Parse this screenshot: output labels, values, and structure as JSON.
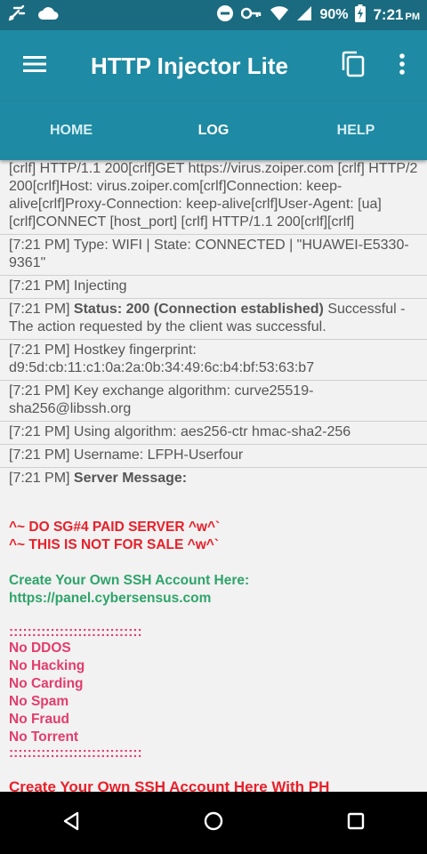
{
  "status_bar": {
    "battery": "90%",
    "time": "7:21",
    "ampm": "PM",
    "icons": [
      "bolt-app-icon",
      "cloud-icon",
      "minus-circle-icon",
      "key-icon",
      "wifi-icon",
      "signal-icon",
      "battery-charging-icon"
    ]
  },
  "app_bar": {
    "title": "HTTP Injector Lite",
    "icons": [
      "menu-icon",
      "copy-icon",
      "more-vert-icon"
    ]
  },
  "tabs": {
    "home": "HOME",
    "log": "LOG",
    "help": "HELP",
    "active": "LOG"
  },
  "log": {
    "payload": "[crlf] HTTP/1.1 200[crlf]GET https://virus.zoiper.com [crlf] HTTP/2 200[crlf]Host: virus.zoiper.com[crlf]Connection: keep-alive[crlf]Proxy-Connection: keep-alive[crlf]User-Agent: [ua][crlf]CONNECT [host_port] [crlf] HTTP/1.1 200[crlf][crlf]",
    "entries": [
      {
        "time": "[7:21 PM]",
        "text": " Type: WIFI | State: CONNECTED | \"HUAWEI-E5330-9361\""
      },
      {
        "time": "[7:21 PM]",
        "text": " Injecting"
      },
      {
        "time": "[7:21 PM]",
        "bold": " Status: 200 (Connection established)",
        "text": " Successful - The action requested by the client was successful."
      },
      {
        "time": "[7:21 PM]",
        "text": " Hostkey fingerprint: d9:5d:cb:11:c1:0a:2a:0b:34:49:6c:b4:bf:53:63:b7"
      },
      {
        "time": "[7:21 PM]",
        "text": " Key exchange algorithm: curve25519-sha256@libssh.org"
      },
      {
        "time": "[7:21 PM]",
        "text": " Using algorithm: aes256-ctr hmac-sha2-256"
      },
      {
        "time": "[7:21 PM]",
        "text": " Username: LFPH-Userfour"
      },
      {
        "time": "[7:21 PM]",
        "bold": " Server Message:"
      }
    ],
    "server_message": {
      "line1": "^~ DO SG#4 PAID SERVER ^w^`",
      "line2": "^~ THIS IS NOT FOR SALE ^w^`",
      "create_title": "Create Your Own SSH Account Here:",
      "create_url": "https://panel.cybersensus.com",
      "separator": ":::::::::::::::::::::::::::::",
      "rules": [
        "No DDOS",
        "No Hacking",
        "No Carding",
        "No Spam",
        "No Fraud",
        "No Torrent"
      ],
      "separator2": ":::::::::::::::::::::::::::::",
      "cut_line": "Create Your Own SSH Account Here With PH"
    },
    "colors": {
      "red": "#e8202a",
      "green": "#2ea46a",
      "pink": "#e23d6d"
    }
  },
  "nav_bar": {
    "icons": [
      "back-triangle-icon",
      "home-circle-icon",
      "recents-square-icon"
    ]
  }
}
